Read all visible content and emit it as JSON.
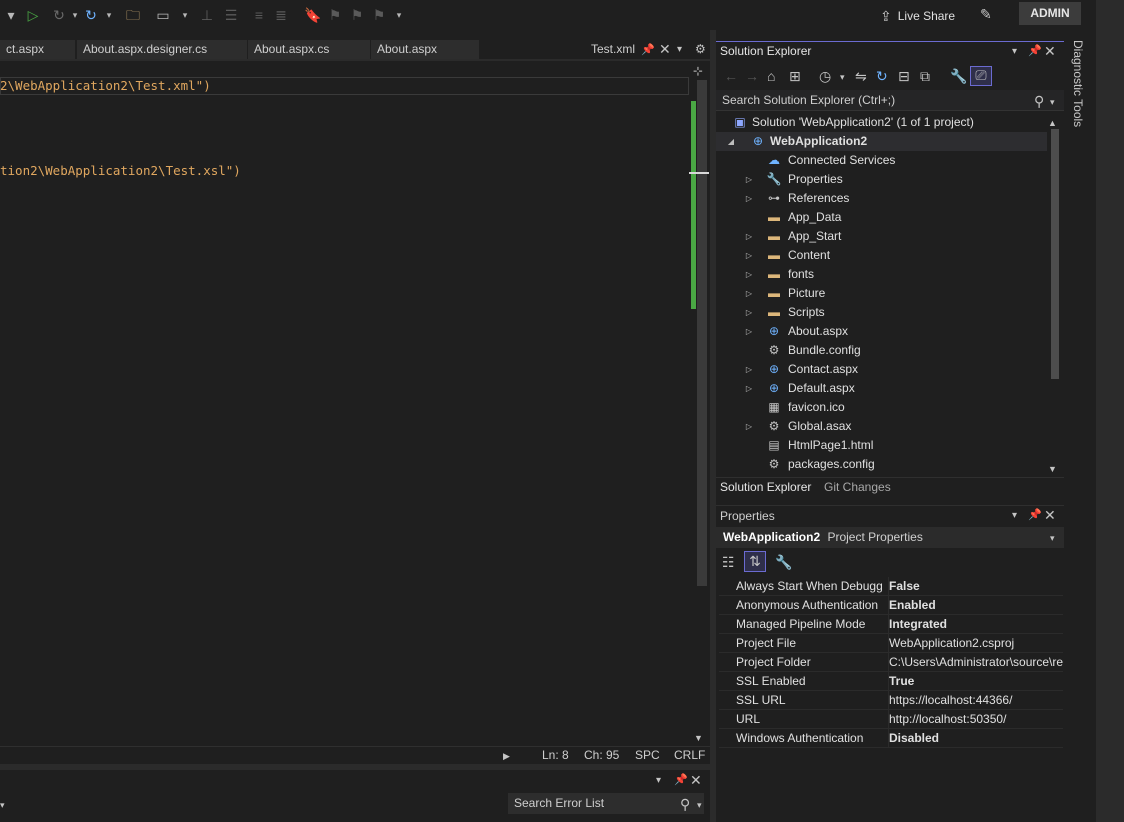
{
  "toolbar": {
    "live_share": "Live Share",
    "account": "ADMIN"
  },
  "editor_tabs": [
    {
      "label": "ct.aspx"
    },
    {
      "label": "About.aspx.designer.cs"
    },
    {
      "label": "About.aspx.cs"
    },
    {
      "label": "About.aspx"
    }
  ],
  "active_tab": {
    "label": "Test.xml"
  },
  "editor": {
    "lines": [
      "2\\WebApplication2\\Test.xml\")",
      "tion2\\WebApplication2\\Test.xsl\")"
    ]
  },
  "status": {
    "line": "Ln: 8",
    "char": "Ch: 95",
    "whitespace": "SPC",
    "line_ending": "CRLF"
  },
  "error_list": {
    "search_placeholder": "Search Error List"
  },
  "solution_explorer": {
    "title": "Solution Explorer",
    "search_placeholder": "Search Solution Explorer (Ctrl+;)",
    "solution": "Solution 'WebApplication2' (1 of 1 project)",
    "project": "WebApplication2",
    "items": [
      {
        "label": "Connected Services",
        "icon": "connected-services-icon",
        "expandable": false
      },
      {
        "label": "Properties",
        "icon": "wrench-icon",
        "expandable": true
      },
      {
        "label": "References",
        "icon": "references-icon",
        "expandable": true
      },
      {
        "label": "App_Data",
        "icon": "folder-icon",
        "expandable": false
      },
      {
        "label": "App_Start",
        "icon": "folder-icon",
        "expandable": true
      },
      {
        "label": "Content",
        "icon": "folder-icon",
        "expandable": true
      },
      {
        "label": "fonts",
        "icon": "folder-icon",
        "expandable": true
      },
      {
        "label": "Picture",
        "icon": "folder-icon",
        "expandable": true
      },
      {
        "label": "Scripts",
        "icon": "folder-icon",
        "expandable": true
      },
      {
        "label": "About.aspx",
        "icon": "web-file-icon",
        "expandable": true
      },
      {
        "label": "Bundle.config",
        "icon": "config-file-icon",
        "expandable": false
      },
      {
        "label": "Contact.aspx",
        "icon": "web-file-icon",
        "expandable": true
      },
      {
        "label": "Default.aspx",
        "icon": "web-file-icon",
        "expandable": true
      },
      {
        "label": "favicon.ico",
        "icon": "image-file-icon",
        "expandable": false
      },
      {
        "label": "Global.asax",
        "icon": "config-file-icon",
        "expandable": true
      },
      {
        "label": "HtmlPage1.html",
        "icon": "html-file-icon",
        "expandable": false
      },
      {
        "label": "packages.config",
        "icon": "config-file-icon",
        "expandable": false
      }
    ],
    "tabs": [
      "Solution Explorer",
      "Git Changes"
    ]
  },
  "properties": {
    "title": "Properties",
    "object_name": "WebApplication2",
    "object_type": "Project Properties",
    "rows": [
      {
        "name": "Always Start When Debugging",
        "value": "False",
        "bold": true
      },
      {
        "name": "Anonymous Authentication",
        "value": "Enabled",
        "bold": true
      },
      {
        "name": "Managed Pipeline Mode",
        "value": "Integrated",
        "bold": true
      },
      {
        "name": "Project File",
        "value": "WebApplication2.csproj",
        "bold": false
      },
      {
        "name": "Project Folder",
        "value": "C:\\Users\\Administrator\\source\\repos",
        "bold": false
      },
      {
        "name": "SSL Enabled",
        "value": "True",
        "bold": true
      },
      {
        "name": "SSL URL",
        "value": "https://localhost:44366/",
        "bold": false
      },
      {
        "name": "URL",
        "value": "http://localhost:50350/",
        "bold": false
      },
      {
        "name": "Windows Authentication",
        "value": "Disabled",
        "bold": true
      }
    ]
  },
  "diagnostic_tools": {
    "label": "Diagnostic Tools"
  },
  "colors": {
    "background": "#1f1f1f",
    "accent": "#6b6bd1",
    "code_string": "#e0a75f",
    "folder": "#dcb67a",
    "change_bar": "#4aa844"
  }
}
